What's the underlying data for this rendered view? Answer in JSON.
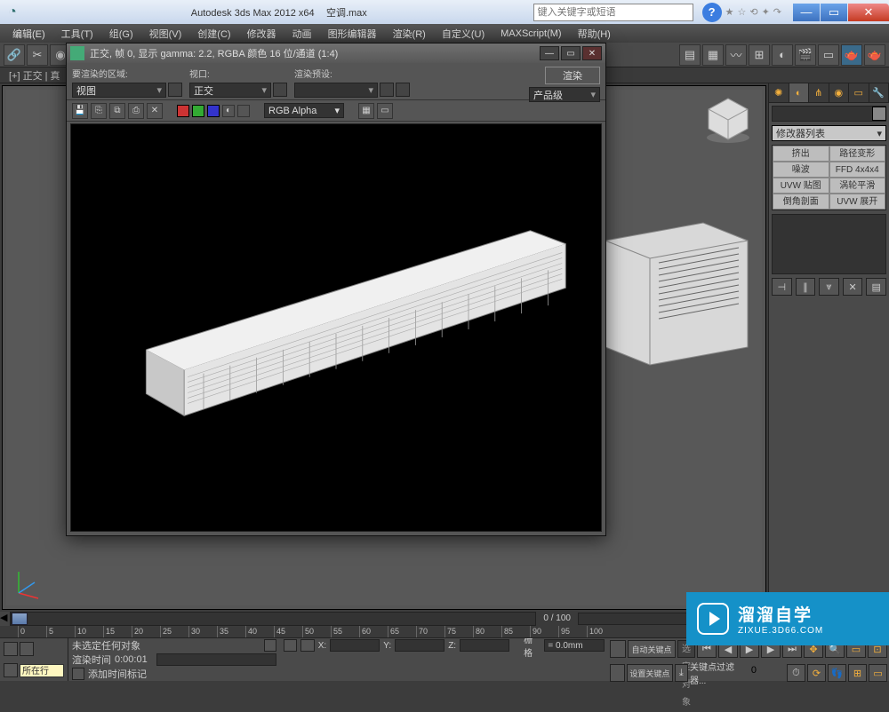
{
  "window": {
    "app_title": "Autodesk 3ds Max  2012  x64",
    "file_name": "空调.max",
    "search_placeholder": "键入关键字或短语"
  },
  "menubar": {
    "items": [
      "编辑(E)",
      "工具(T)",
      "组(G)",
      "视图(V)",
      "创建(C)",
      "修改器",
      "动画",
      "图形编辑器",
      "渲染(R)",
      "自定义(U)",
      "MAXScript(M)",
      "帮助(H)"
    ]
  },
  "tabstrip": {
    "label": "[+] 正交 | 真"
  },
  "render_window": {
    "title": "正交, 帧 0, 显示 gamma: 2.2, RGBA 颜色 16 位/通道 (1:4)",
    "region_label": "要渲染的区域:",
    "region_value": "视图",
    "viewport_label": "视口:",
    "viewport_value": "正交",
    "preset_label": "渲染预设:",
    "preset_value": "",
    "output_label": "",
    "output_value": "产品级",
    "render_btn": "渲染",
    "channel": "RGB Alpha"
  },
  "cmd_panel": {
    "mod_combo": "修改器列表",
    "grid": [
      [
        "挤出",
        "路径变形"
      ],
      [
        "噪波",
        "FFD 4x4x4"
      ],
      [
        "UVW 贴图",
        "涡轮平滑"
      ],
      [
        "倒角剖面",
        "UVW 展开"
      ]
    ]
  },
  "status": {
    "no_selection": "未选定任何对象",
    "add_marker": "添加时间标记",
    "render_time_label": "渲染时间",
    "render_time_value": "0:00:01",
    "grid_label": "栅格",
    "grid_value": "= 0.0mm",
    "autokey": "自动关键点",
    "setkey": "设置关键点",
    "selset": "选定对象",
    "keyfilter": "关键点过滤器...",
    "current_row": "所在行",
    "timeline": "0 / 100"
  },
  "ruler_ticks": [
    0,
    5,
    10,
    15,
    20,
    25,
    30,
    35,
    40,
    45,
    50,
    55,
    60,
    65,
    70,
    75,
    80,
    85,
    90,
    95,
    100
  ],
  "watermark": {
    "brand": "溜溜自学",
    "url": "ZIXUE.3D66.COM"
  },
  "coords": {
    "x": "X:",
    "y": "Y:",
    "z": "Z:"
  }
}
